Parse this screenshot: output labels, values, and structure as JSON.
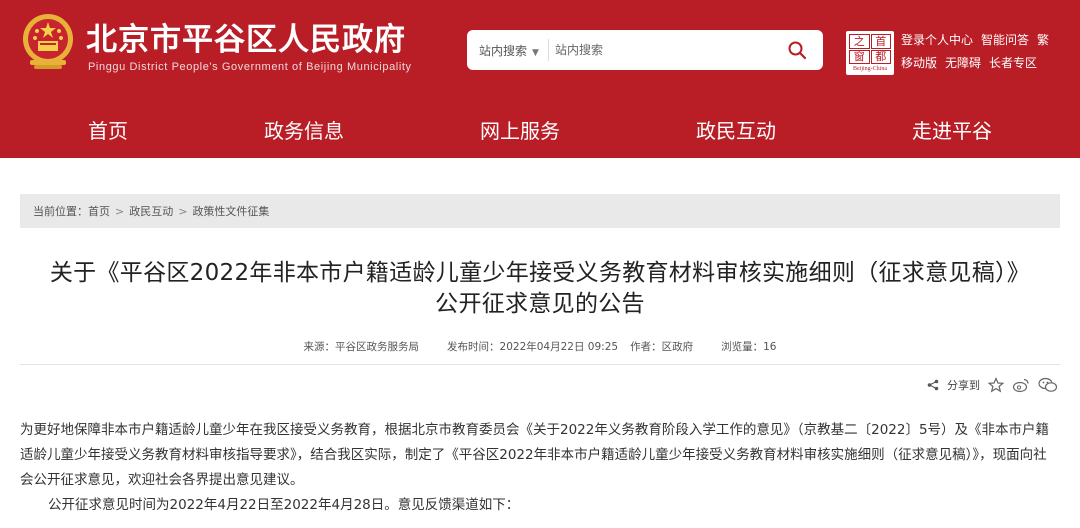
{
  "header": {
    "title_cn": "北京市平谷区人民政府",
    "title_en": "Pinggu District People's Government of Beijing Municipality",
    "search": {
      "scope": "站内搜索",
      "placeholder": "站内搜索"
    },
    "capital_logo": {
      "chars": [
        "之",
        "首",
        "窗",
        "都"
      ],
      "en": "Beijing-China"
    },
    "quick_links_row1": [
      "登录",
      "个人中心",
      "智能问答",
      "繁"
    ],
    "quick_links_row2": [
      "移动版",
      "无障碍",
      "长者专区"
    ]
  },
  "nav": {
    "items": [
      "首页",
      "政务信息",
      "网上服务",
      "政民互动",
      "走进平谷"
    ]
  },
  "breadcrumb": {
    "prefix": "当前位置：",
    "items": [
      "首页",
      "政民互动",
      "政策性文件征集"
    ],
    "separator": ">"
  },
  "article": {
    "title_line1": "关于《平谷区2022年非本市户籍适龄儿童少年接受义务教育材料审核实施细则（征求意见稿）》",
    "title_line2": "公开征求意见的公告",
    "meta": {
      "source": "来源：平谷区政务服务局",
      "published": "发布时间：2022年04月22日 09:25",
      "author": "作者：区政府",
      "views": "浏览量：16"
    },
    "share_label": "分享到",
    "paragraph1": "为更好地保障非本市户籍适龄儿童少年在我区接受义务教育，根据北京市教育委员会《关于2022年义务教育阶段入学工作的意见》（京教基二〔2022〕5号）及《非本市户籍适龄儿童少年接受义务教育材料审核指导要求》，结合我区实际，制定了《平谷区2022年非本市户籍适龄儿童少年接受义务教育材料审核实施细则（征求意见稿）》，现面向社会公开征求意见，欢迎社会各界提出意见建议。",
    "paragraph2": "公开征求意见时间为2022年4月22日至2022年4月28日。意见反馈渠道如下："
  },
  "colors": {
    "brand_red": "#b91d26",
    "breadcrumb_bg": "#e9e9e9"
  }
}
